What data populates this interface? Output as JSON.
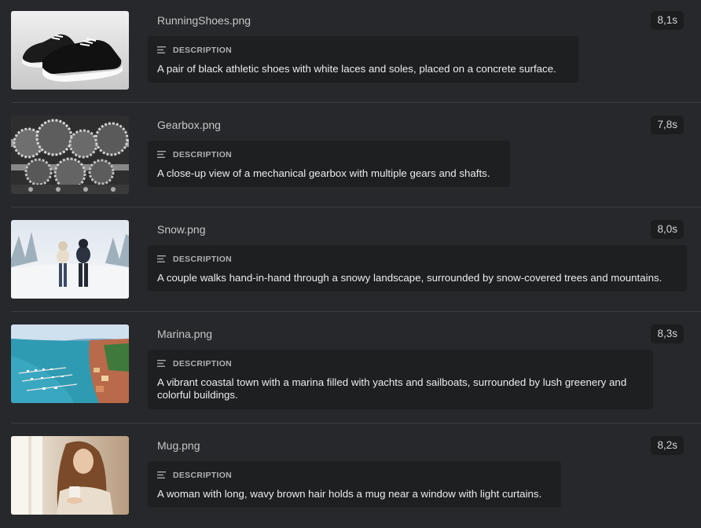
{
  "items": [
    {
      "filename": "RunningShoes.png",
      "time": "8,1s",
      "description_label": "DESCRIPTION",
      "description": "A pair of black athletic shoes with white laces and soles, placed on a concrete surface.",
      "thumbnail_icon": "shoes-image"
    },
    {
      "filename": "Gearbox.png",
      "time": "7,8s",
      "description_label": "DESCRIPTION",
      "description": "A close-up view of a mechanical gearbox with multiple gears and shafts.",
      "thumbnail_icon": "gearbox-image"
    },
    {
      "filename": "Snow.png",
      "time": "8,0s",
      "description_label": "DESCRIPTION",
      "description": "A couple walks hand-in-hand through a snowy landscape, surrounded by snow-covered trees and mountains.",
      "thumbnail_icon": "snow-image"
    },
    {
      "filename": "Marina.png",
      "time": "8,3s",
      "description_label": "DESCRIPTION",
      "description": "A vibrant coastal town with a marina filled with yachts and sailboats, surrounded by lush greenery and colorful buildings.",
      "thumbnail_icon": "marina-image"
    },
    {
      "filename": "Mug.png",
      "time": "8,2s",
      "description_label": "DESCRIPTION",
      "description": "A woman with long, wavy brown hair holds a mug near a window with light curtains.",
      "thumbnail_icon": "mug-image"
    }
  ]
}
